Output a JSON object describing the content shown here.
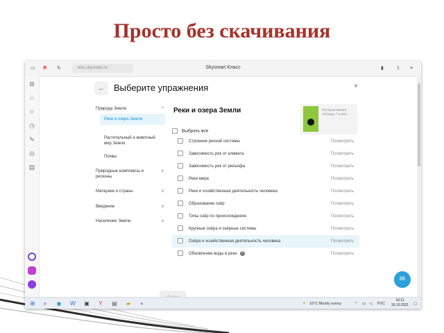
{
  "slide": {
    "title": "Просто без скачивания"
  },
  "browser": {
    "nav_yandex": "Я",
    "nav_reload": "↻",
    "url": "edu.skysmart.ru",
    "page_title": "Skysmart Класс"
  },
  "modal": {
    "back_label": "←",
    "title": "Выберите упражнения",
    "close_label": "×",
    "content_title": "Реки и озера Земли",
    "card_text": "Интерактивная тетрадь 7 класс",
    "select_all": "Выбрать все",
    "footer_button": "Далее"
  },
  "menu": {
    "top": "Природа Земли",
    "subs": [
      {
        "label": "Реки и озера Земли"
      },
      {
        "label": "Растительный и животный мир Земли"
      },
      {
        "label": "Почвы"
      }
    ],
    "sections": [
      {
        "label": "Природные комплексы и регионы"
      },
      {
        "label": "Материки и страны"
      },
      {
        "label": "Введение"
      },
      {
        "label": "Население Земли"
      }
    ]
  },
  "exercises": {
    "view_label": "Посмотреть",
    "items": [
      {
        "label": "Строение речной системы"
      },
      {
        "label": "Зависимость рек от климата"
      },
      {
        "label": "Зависимость рек от рельефа"
      },
      {
        "label": "Реки мира"
      },
      {
        "label": "Реки и хозяйственная деятельность человека"
      },
      {
        "label": "Образование озёр"
      },
      {
        "label": "Типы озёр по происхождению"
      },
      {
        "label": "Крупные озёра и озёрные системы"
      },
      {
        "label": "Озёра и хозяйственная деятельность человека"
      },
      {
        "label": "Обновление воды в реке"
      }
    ]
  },
  "taskbar": {
    "weather": "10°C Mostly sunny",
    "lang": "РУС",
    "time": "10:11",
    "date": "16.10.2021"
  },
  "colors": {
    "title": "#a5322a",
    "accent": "#1a8fd1",
    "highlight": "#e6f4fb"
  },
  "icons": [
    "bookmark-icon",
    "bell-icon",
    "star-icon",
    "history-icon",
    "collection-icon",
    "download-icon",
    "document-icon",
    "chat-icon",
    "search-icon",
    "windows-logo-icon"
  ]
}
